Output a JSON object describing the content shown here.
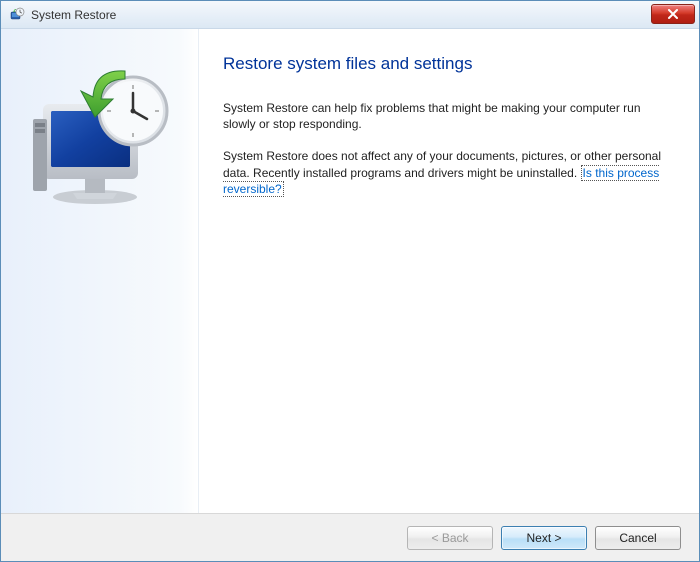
{
  "titlebar": {
    "title": "System Restore"
  },
  "main": {
    "heading": "Restore system files and settings",
    "paragraph1": "System Restore can help fix problems that might be making your computer run slowly or stop responding.",
    "paragraph2_a": "System Restore does not affect any of your documents, pictures, or other personal data. Recently installed programs and drivers might be uninstalled. ",
    "link_text": "Is this process reversible?"
  },
  "buttons": {
    "back": "< Back",
    "next": "Next >",
    "cancel": "Cancel"
  }
}
